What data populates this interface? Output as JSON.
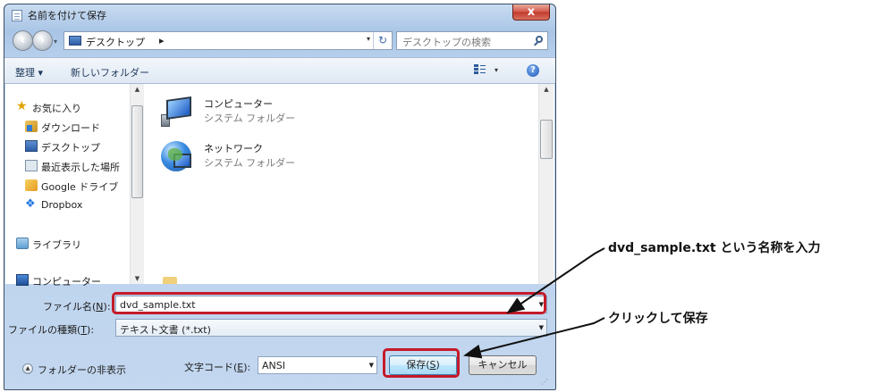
{
  "window": {
    "title": "名前を付けて保存",
    "close_label": "x"
  },
  "address": {
    "location": "デスクトップ",
    "separator": "▸",
    "refresh": "↻"
  },
  "search": {
    "placeholder": "デスクトップの検索"
  },
  "toolbar": {
    "organize": "整理 ▾",
    "new_folder": "新しいフォルダー",
    "view_dropdown": "▾",
    "help": "?"
  },
  "nav": {
    "items": [
      {
        "label": "お気に入り",
        "icon": "star-icon"
      },
      {
        "label": "ダウンロード",
        "icon": "downloads-folder-icon"
      },
      {
        "label": "デスクトップ",
        "icon": "desktop-icon"
      },
      {
        "label": "最近表示した場所",
        "icon": "recent-places-icon"
      },
      {
        "label": "Google ドライブ",
        "icon": "google-drive-icon"
      },
      {
        "label": "Dropbox",
        "icon": "dropbox-icon"
      },
      {
        "label": "ライブラリ",
        "icon": "library-icon"
      },
      {
        "label": "コンピューター",
        "icon": "computer-icon"
      }
    ]
  },
  "files": [
    {
      "name": "コンピューター",
      "type": "システム フォルダー",
      "icon": "computer-large-icon"
    },
    {
      "name": "ネットワーク",
      "type": "システム フォルダー",
      "icon": "network-large-icon"
    }
  ],
  "form": {
    "filename_label_pre": "ファイル名(",
    "filename_label_key": "N",
    "filename_label_post": "):",
    "filename_value": "dvd_sample.txt",
    "filetype_label_pre": "ファイルの種類(",
    "filetype_label_key": "T",
    "filetype_label_post": "):",
    "filetype_value": "テキスト文書 (*.txt)",
    "encoding_label_pre": "文字コード(",
    "encoding_label_key": "E",
    "encoding_label_post": "):",
    "encoding_value": "ANSI",
    "hide_folders": "フォルダーの非表示",
    "save_pre": "保存(",
    "save_key": "S",
    "save_post": ")",
    "cancel": "キャンセル"
  },
  "annotations": {
    "filename_note": "dvd_sample.txt という名称を入力",
    "save_note": "クリックして保存"
  },
  "colors": {
    "highlight": "#c51a2a",
    "titlebar": "#b6cfec"
  }
}
